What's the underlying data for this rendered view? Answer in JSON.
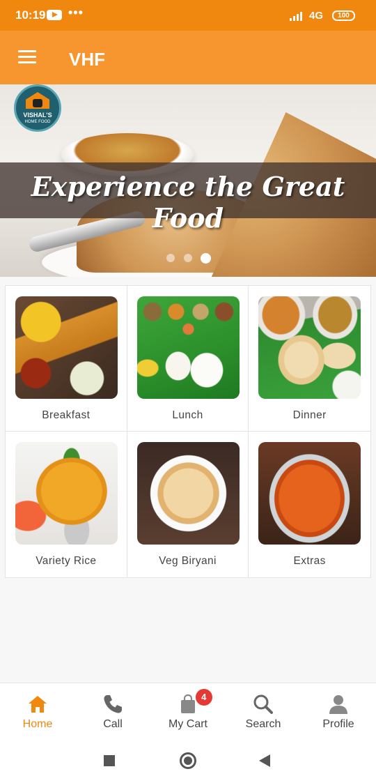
{
  "status_bar": {
    "time": "10:19",
    "more": "•••",
    "network": "4G",
    "battery": "100"
  },
  "app_bar": {
    "title": "VHF"
  },
  "banner": {
    "headline": "Experience the Great Food",
    "logo_name": "VISHAL'S",
    "logo_sub": "HOME FOOD",
    "slide_count": 3,
    "active_slide": 3
  },
  "categories": [
    {
      "label": "Breakfast",
      "icon": "breakfast-image"
    },
    {
      "label": "Lunch",
      "icon": "lunch-image"
    },
    {
      "label": "Dinner",
      "icon": "dinner-image"
    },
    {
      "label": "Variety Rice",
      "icon": "variety-rice-image"
    },
    {
      "label": "Veg Biryani",
      "icon": "veg-biryani-image"
    },
    {
      "label": "Extras",
      "icon": "extras-image"
    }
  ],
  "bottom_nav": {
    "items": [
      {
        "label": "Home",
        "icon": "home-icon",
        "active": true
      },
      {
        "label": "Call",
        "icon": "phone-icon",
        "active": false
      },
      {
        "label": "My Cart",
        "icon": "cart-bag-icon",
        "active": false
      },
      {
        "label": "Search",
        "icon": "search-icon",
        "active": false
      },
      {
        "label": "Profile",
        "icon": "profile-icon",
        "active": false
      }
    ],
    "cart_count": "4"
  },
  "colors": {
    "status_bar": "#f0870f",
    "app_bar": "#f7962f",
    "accent": "#f0870f",
    "badge": "#e53935"
  }
}
